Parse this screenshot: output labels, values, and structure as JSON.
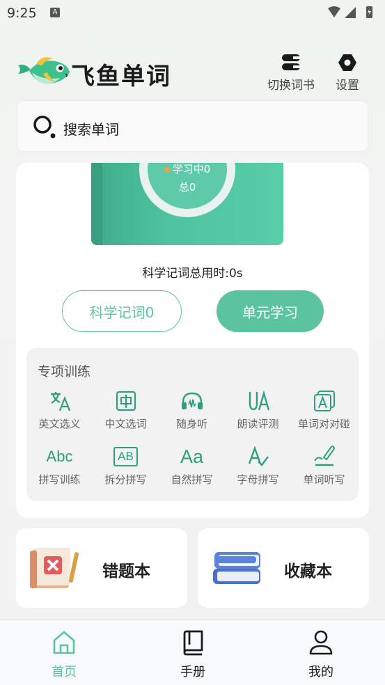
{
  "status": {
    "time": "9:25",
    "a_badge": "A"
  },
  "header": {
    "title": "飞鱼单词",
    "switch_book": "切换词书",
    "settings": "设置"
  },
  "search": {
    "placeholder": "搜索单词"
  },
  "progress": {
    "learning": "学习中0",
    "total": "总0",
    "total_time": "科学记词总用时:0s"
  },
  "buttons": {
    "science": "科学记词0",
    "unit": "单元学习"
  },
  "training": {
    "title": "专项训练",
    "items": [
      {
        "label": "英文选义",
        "icon": "translate-icon"
      },
      {
        "label": "中文选词",
        "icon": "chinese-char-icon"
      },
      {
        "label": "随身听",
        "icon": "headphones-icon"
      },
      {
        "label": "朗读评测",
        "icon": "read-aloud-icon"
      },
      {
        "label": "单词对对碰",
        "icon": "word-match-icon"
      },
      {
        "label": "拼写训练",
        "icon": "abc-icon",
        "glyph": "Abc"
      },
      {
        "label": "拆分拼写",
        "icon": "ab-split-icon",
        "glyph": "AB"
      },
      {
        "label": "自然拼写",
        "icon": "phonics-icon",
        "glyph": "Aa"
      },
      {
        "label": "字母拼写",
        "icon": "letter-spell-icon"
      },
      {
        "label": "单词听写",
        "icon": "dictation-icon"
      }
    ]
  },
  "cards": {
    "wrong": "错题本",
    "favorite": "收藏本"
  },
  "tabs": {
    "home": "首页",
    "manual": "手册",
    "mine": "我的"
  },
  "colors": {
    "accent": "#5bc39f",
    "accent_dark": "#2e9f7e",
    "badge": "#f2a23c"
  }
}
